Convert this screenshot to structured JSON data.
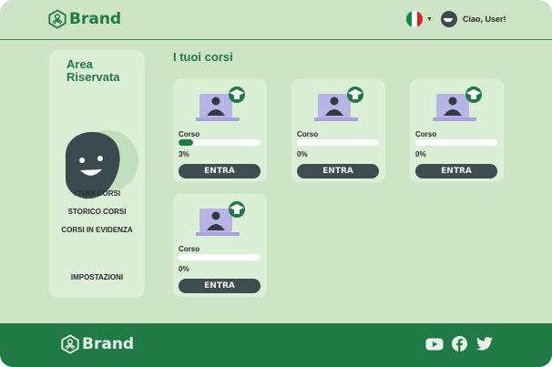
{
  "header": {
    "brand": "Brand",
    "user_greeting": "Ciao, User!",
    "flag_colors": [
      "#0f8a3c",
      "#ffffff",
      "#d62828"
    ]
  },
  "sidebar": {
    "title": "Area Riservata",
    "items": [
      {
        "label": "I TUOI CORSI"
      },
      {
        "label": "STORICO CORSI"
      },
      {
        "label": "CORSI IN EVIDENZA"
      },
      {
        "label": "IMPOSTAZIONI"
      }
    ]
  },
  "main": {
    "section_title": "I tuoi corsi",
    "courses": [
      {
        "name": "Corso",
        "progress_label": "3%",
        "progress": 0.03,
        "button": "ENTRA"
      },
      {
        "name": "Corso",
        "progress_label": "0%",
        "progress": 0,
        "button": "ENTRA"
      },
      {
        "name": "Corso",
        "progress_label": "0%",
        "progress": 0,
        "button": "ENTRA"
      },
      {
        "name": "Corso",
        "progress_label": "0%",
        "progress": 0,
        "button": "ENTRA"
      }
    ]
  },
  "footer": {
    "brand": "Brand",
    "social_icons": [
      "youtube-icon",
      "facebook-icon",
      "twitter-icon"
    ]
  },
  "colors": {
    "background": "#cde4c6",
    "panel": "#dbeed6",
    "brand_green": "#1f7a45",
    "button_dark": "#3f4d51"
  }
}
